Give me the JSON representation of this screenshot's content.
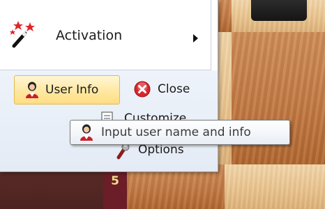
{
  "menu": {
    "activation": {
      "label": "Activation",
      "icon": "magic-wand-icon",
      "has_submenu": true
    },
    "user_info": {
      "label": "User Info",
      "icon": "user-icon",
      "state": "hovered"
    },
    "close": {
      "label": "Close",
      "icon": "close-icon"
    },
    "customize": {
      "label": "Customize",
      "icon": "customize-icon"
    },
    "options": {
      "label": "Options",
      "icon": "wrench-icon"
    }
  },
  "tooltip": {
    "text": "Input user name and info",
    "icon": "user-icon"
  },
  "board": {
    "coordinate_label": "5"
  },
  "colors": {
    "hover_fill": "#ffe9a6",
    "hover_border": "#e3b951",
    "close_icon_red": "#d9262b",
    "coordinate_text": "#f3df8a"
  }
}
